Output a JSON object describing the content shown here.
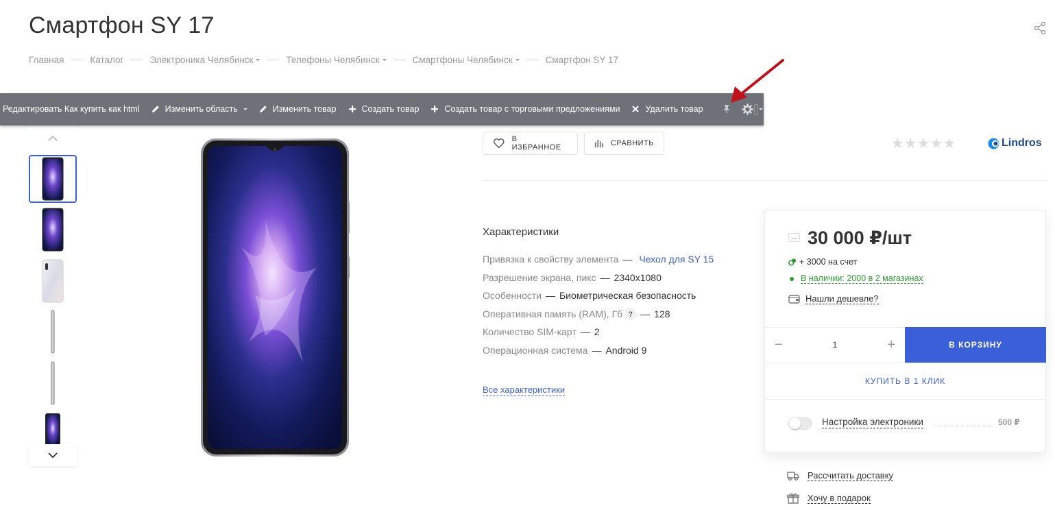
{
  "page": {
    "title": "Смартфон SY 17"
  },
  "breadcrumb": [
    {
      "label": "Главная",
      "has_caret": false
    },
    {
      "label": "Каталог",
      "has_caret": false
    },
    {
      "label": "Электроника Челябинск",
      "has_caret": true
    },
    {
      "label": "Телефоны Челябинск",
      "has_caret": true
    },
    {
      "label": "Смартфоны Челябинск",
      "has_caret": true
    },
    {
      "label": "Смартфон SY 17",
      "has_caret": false
    }
  ],
  "admin_bar": {
    "edit_html": "Редактировать Как купить как html",
    "edit_area": "Изменить область",
    "edit_product": "Изменить товар",
    "create_product": "Создать товар",
    "create_with_offers": "Создать товар с торговыми предложениями",
    "delete_product": "Удалить товар"
  },
  "actions": {
    "favorite": "В ИЗБРАННОЕ",
    "compare": "СРАВНИТЬ"
  },
  "rating": {
    "stars_filled": 0,
    "stars_total": 5
  },
  "brand": {
    "name": "Lindros"
  },
  "characteristics": {
    "title": "Характеристики",
    "rows": [
      {
        "label": "Привязка к свойству элемента",
        "value": "Чехол для SY 15",
        "is_link": true,
        "help": ""
      },
      {
        "label": "Разрешение экрана, пикс",
        "value": "2340x1080",
        "is_link": false,
        "help": ""
      },
      {
        "label": "Особенности",
        "value": "Биометрическая безопасность",
        "is_link": false,
        "help": ""
      },
      {
        "label": "Оперативная память (RAM), Гб",
        "value": "128",
        "is_link": false,
        "help": "?"
      },
      {
        "label": "Количество SIM-карт",
        "value": "2",
        "is_link": false,
        "help": ""
      },
      {
        "label": "Операционная система",
        "value": "Android 9",
        "is_link": false,
        "help": ""
      }
    ],
    "all_link": "Все характеристики"
  },
  "buy": {
    "dots": "...",
    "price": "30 000 ₽/шт",
    "bonus": "+ 3000 на счет",
    "stock": "В наличии: 2000 в 2 магазинах",
    "cheaper": "Нашли дешевле?",
    "qty_minus": "−",
    "qty_value": "1",
    "qty_plus": "+",
    "to_cart": "В КОРЗИНУ",
    "one_click": "КУПИТЬ В 1 КЛИК",
    "service_name": "Настройка электроники",
    "service_price": "500 ₽",
    "service_enabled": false
  },
  "extra_links": {
    "delivery": "Рассчитать доставку",
    "gift": "Хочу в подарок"
  },
  "colors": {
    "accent": "#3b5fd9",
    "admin_bar": "#6e7278",
    "stock": "#2e9e2e",
    "arrow": "#c0121b"
  }
}
